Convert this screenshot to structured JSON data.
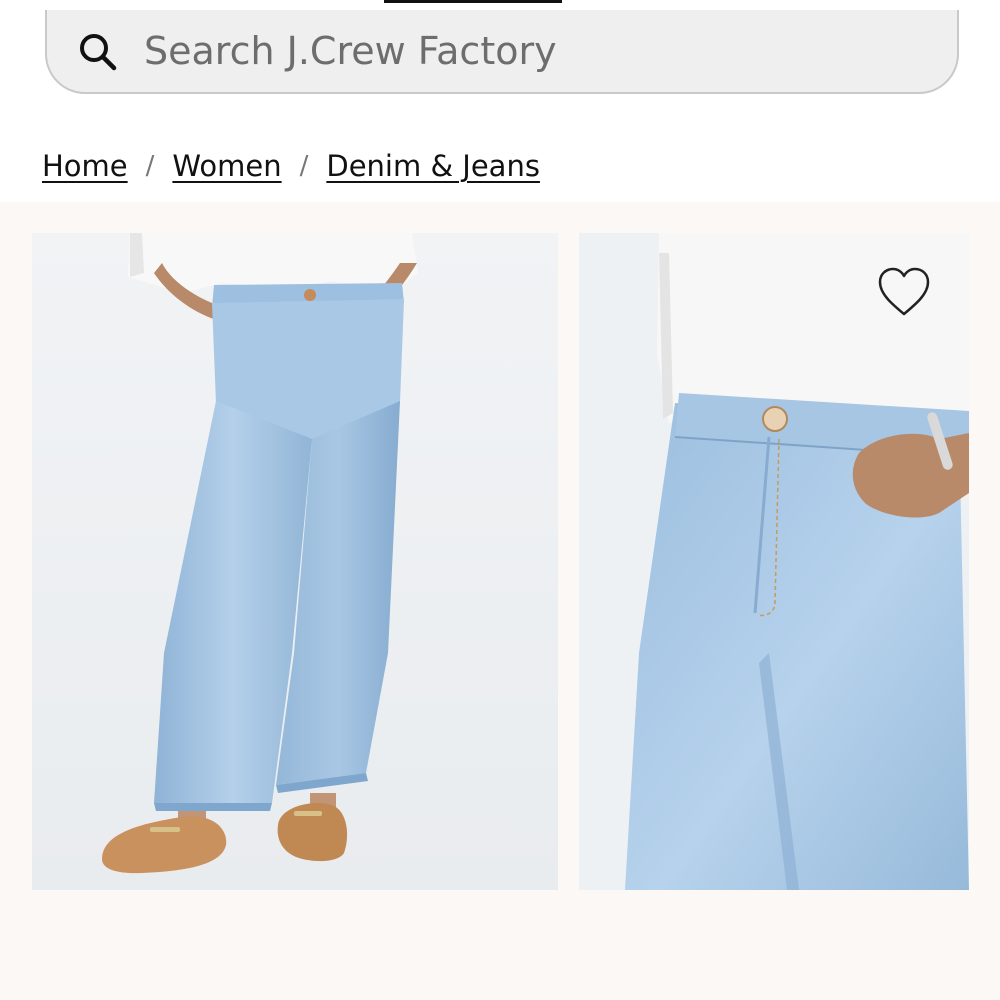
{
  "search": {
    "placeholder": "Search J.Crew Factory",
    "icon": "search-icon"
  },
  "breadcrumb": {
    "items": [
      {
        "label": "Home"
      },
      {
        "label": "Women"
      },
      {
        "label": "Denim & Jeans"
      }
    ],
    "separator": "/"
  },
  "product_images": [
    {
      "name": "full-length-view",
      "icon": "product-photo"
    },
    {
      "name": "waist-detail-view",
      "icon": "product-photo"
    }
  ],
  "wishlist": {
    "icon": "heart-icon"
  },
  "colors": {
    "background": "#ffffff",
    "gallery_bg": "#fbf8f6",
    "search_bg": "#efefef",
    "denim": "#9fc0df",
    "shirt": "#f7f7f7",
    "shoe": "#c9915e"
  }
}
